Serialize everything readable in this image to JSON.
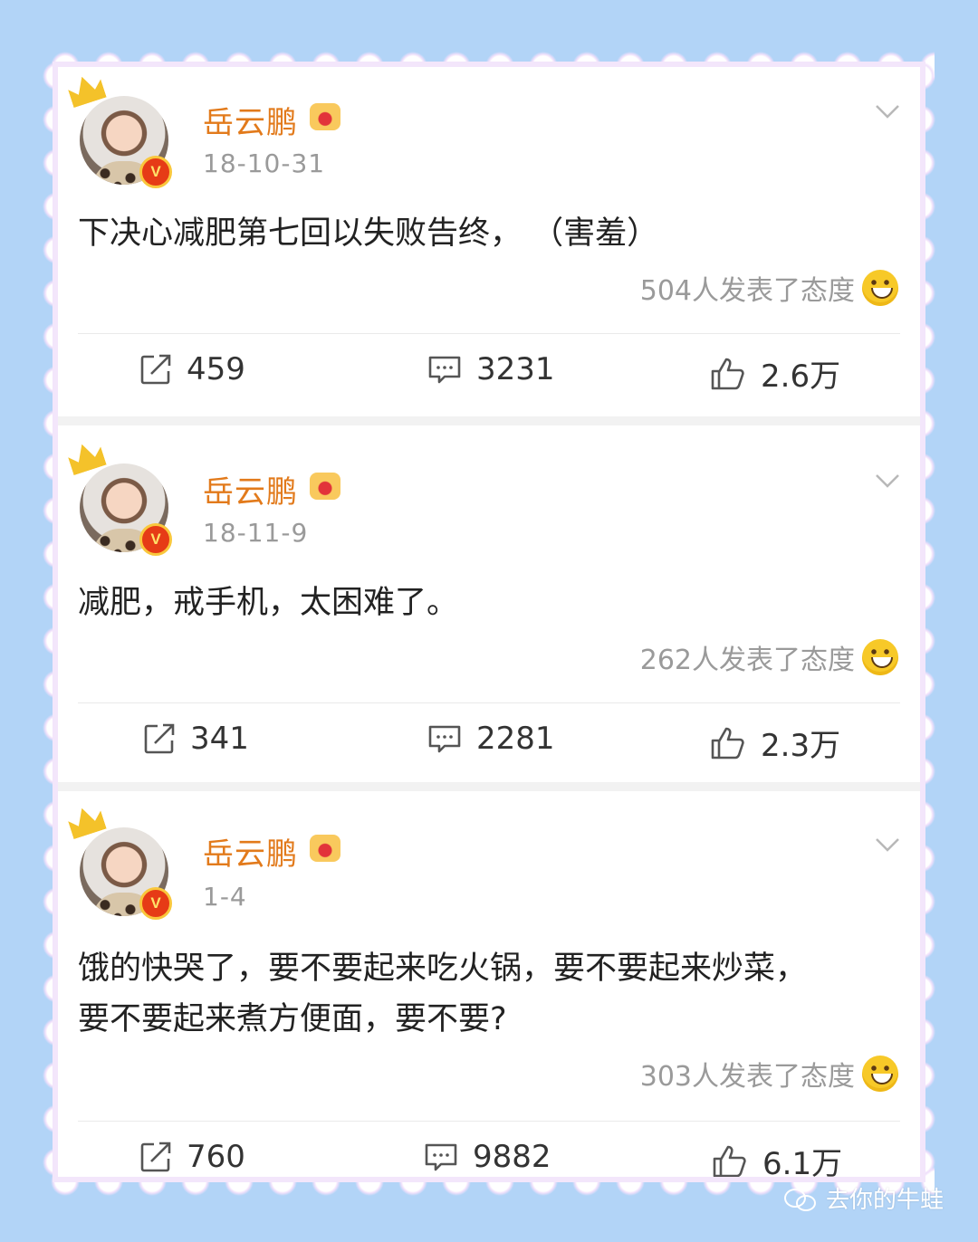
{
  "posts": [
    {
      "username": "岳云鹏",
      "date": "18-10-31",
      "content_lines": [
        "下决心减肥第七回以失败告终， （害羞）"
      ],
      "reactions": "504人发表了态度",
      "reposts": "459",
      "comments": "3231",
      "likes": "2.6万"
    },
    {
      "username": "岳云鹏",
      "date": "18-11-9",
      "content_lines": [
        "减肥，戒手机，太困难了。"
      ],
      "reactions": "262人发表了态度",
      "reposts": "341",
      "comments": "2281",
      "likes": "2.3万"
    },
    {
      "username": "岳云鹏",
      "date": "1-4",
      "content_lines": [
        "饿的快哭了，要不要起来吃火锅，要不要起来炒菜，",
        "要不要起来煮方便面，要不要?"
      ],
      "reactions": "303人发表了态度",
      "reposts": "760",
      "comments": "9882",
      "likes": "6.1万"
    }
  ],
  "badge": "V",
  "watermark": "去你的牛蛙",
  "icons": {
    "avatar_badge": "verified-v-icon",
    "vip": "crown-vip-icon",
    "menu": "chevron-down-icon",
    "repost": "repost-icon",
    "comment": "comment-icon",
    "like": "thumbs-up-icon",
    "reaction": "laughing-face-icon"
  },
  "colors": {
    "background": "#b2d4f7",
    "username": "#e27a1b",
    "verified": "#e63b16",
    "crown": "#f4c22a"
  }
}
